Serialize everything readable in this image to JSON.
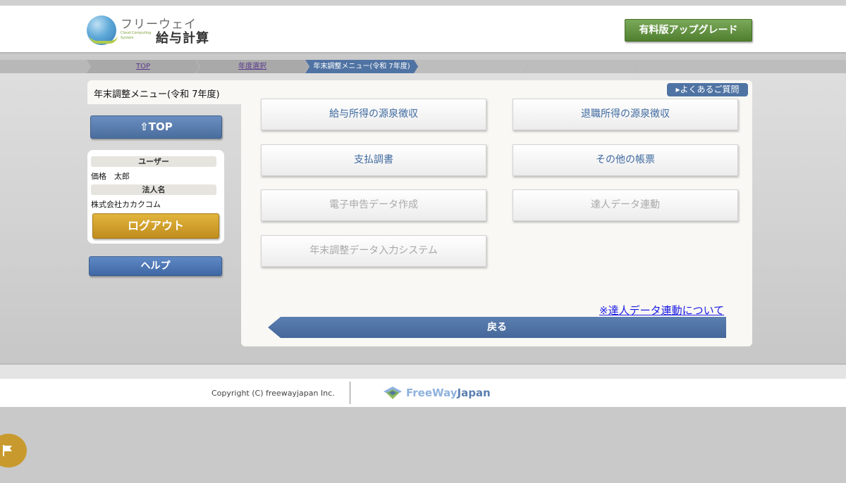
{
  "header": {
    "logo_top": "フリーウェイ",
    "logo_sub": "Cloud Computing System",
    "logo_main": "給与計算",
    "upgrade_label": "有料版アップグレード"
  },
  "breadcrumb": {
    "items": [
      {
        "label": "TOP"
      },
      {
        "label": "年度選択"
      },
      {
        "label": "年末調整メニュー(令和 7年度)"
      }
    ]
  },
  "page": {
    "title": "年末調整メニュー(令和 7年度)",
    "faq_label": "▸よくあるご質問"
  },
  "sidebar": {
    "top_label": "⇧TOP",
    "user_label": "ユーザー",
    "user_value": "価格　太郎",
    "corp_label": "法人名",
    "corp_value": "株式会社カカクコム",
    "logout_label": "ログアウト",
    "help_label": "ヘルプ"
  },
  "menu": {
    "buttons": [
      {
        "label": "給与所得の源泉徴収",
        "enabled": true
      },
      {
        "label": "退職所得の源泉徴収",
        "enabled": true
      },
      {
        "label": "支払調書",
        "enabled": true
      },
      {
        "label": "その他の帳票",
        "enabled": true
      },
      {
        "label": "電子申告データ作成",
        "enabled": false
      },
      {
        "label": "達人データ連動",
        "enabled": false
      },
      {
        "label": "年末調整データ入力システム",
        "enabled": false
      }
    ],
    "tatsujin_link": "※達人データ連動について",
    "back_label": "戻る"
  },
  "footer": {
    "copyright": "Copyright (C) freewayjapan Inc.",
    "logo_free": "FreeWay",
    "logo_japan": "Japan"
  },
  "colors": {
    "accent_blue": "#4f73a3",
    "upgrade_green": "#5f8f3d",
    "logout_gold": "#d4a52e",
    "disabled_text": "#a9a9a9"
  }
}
